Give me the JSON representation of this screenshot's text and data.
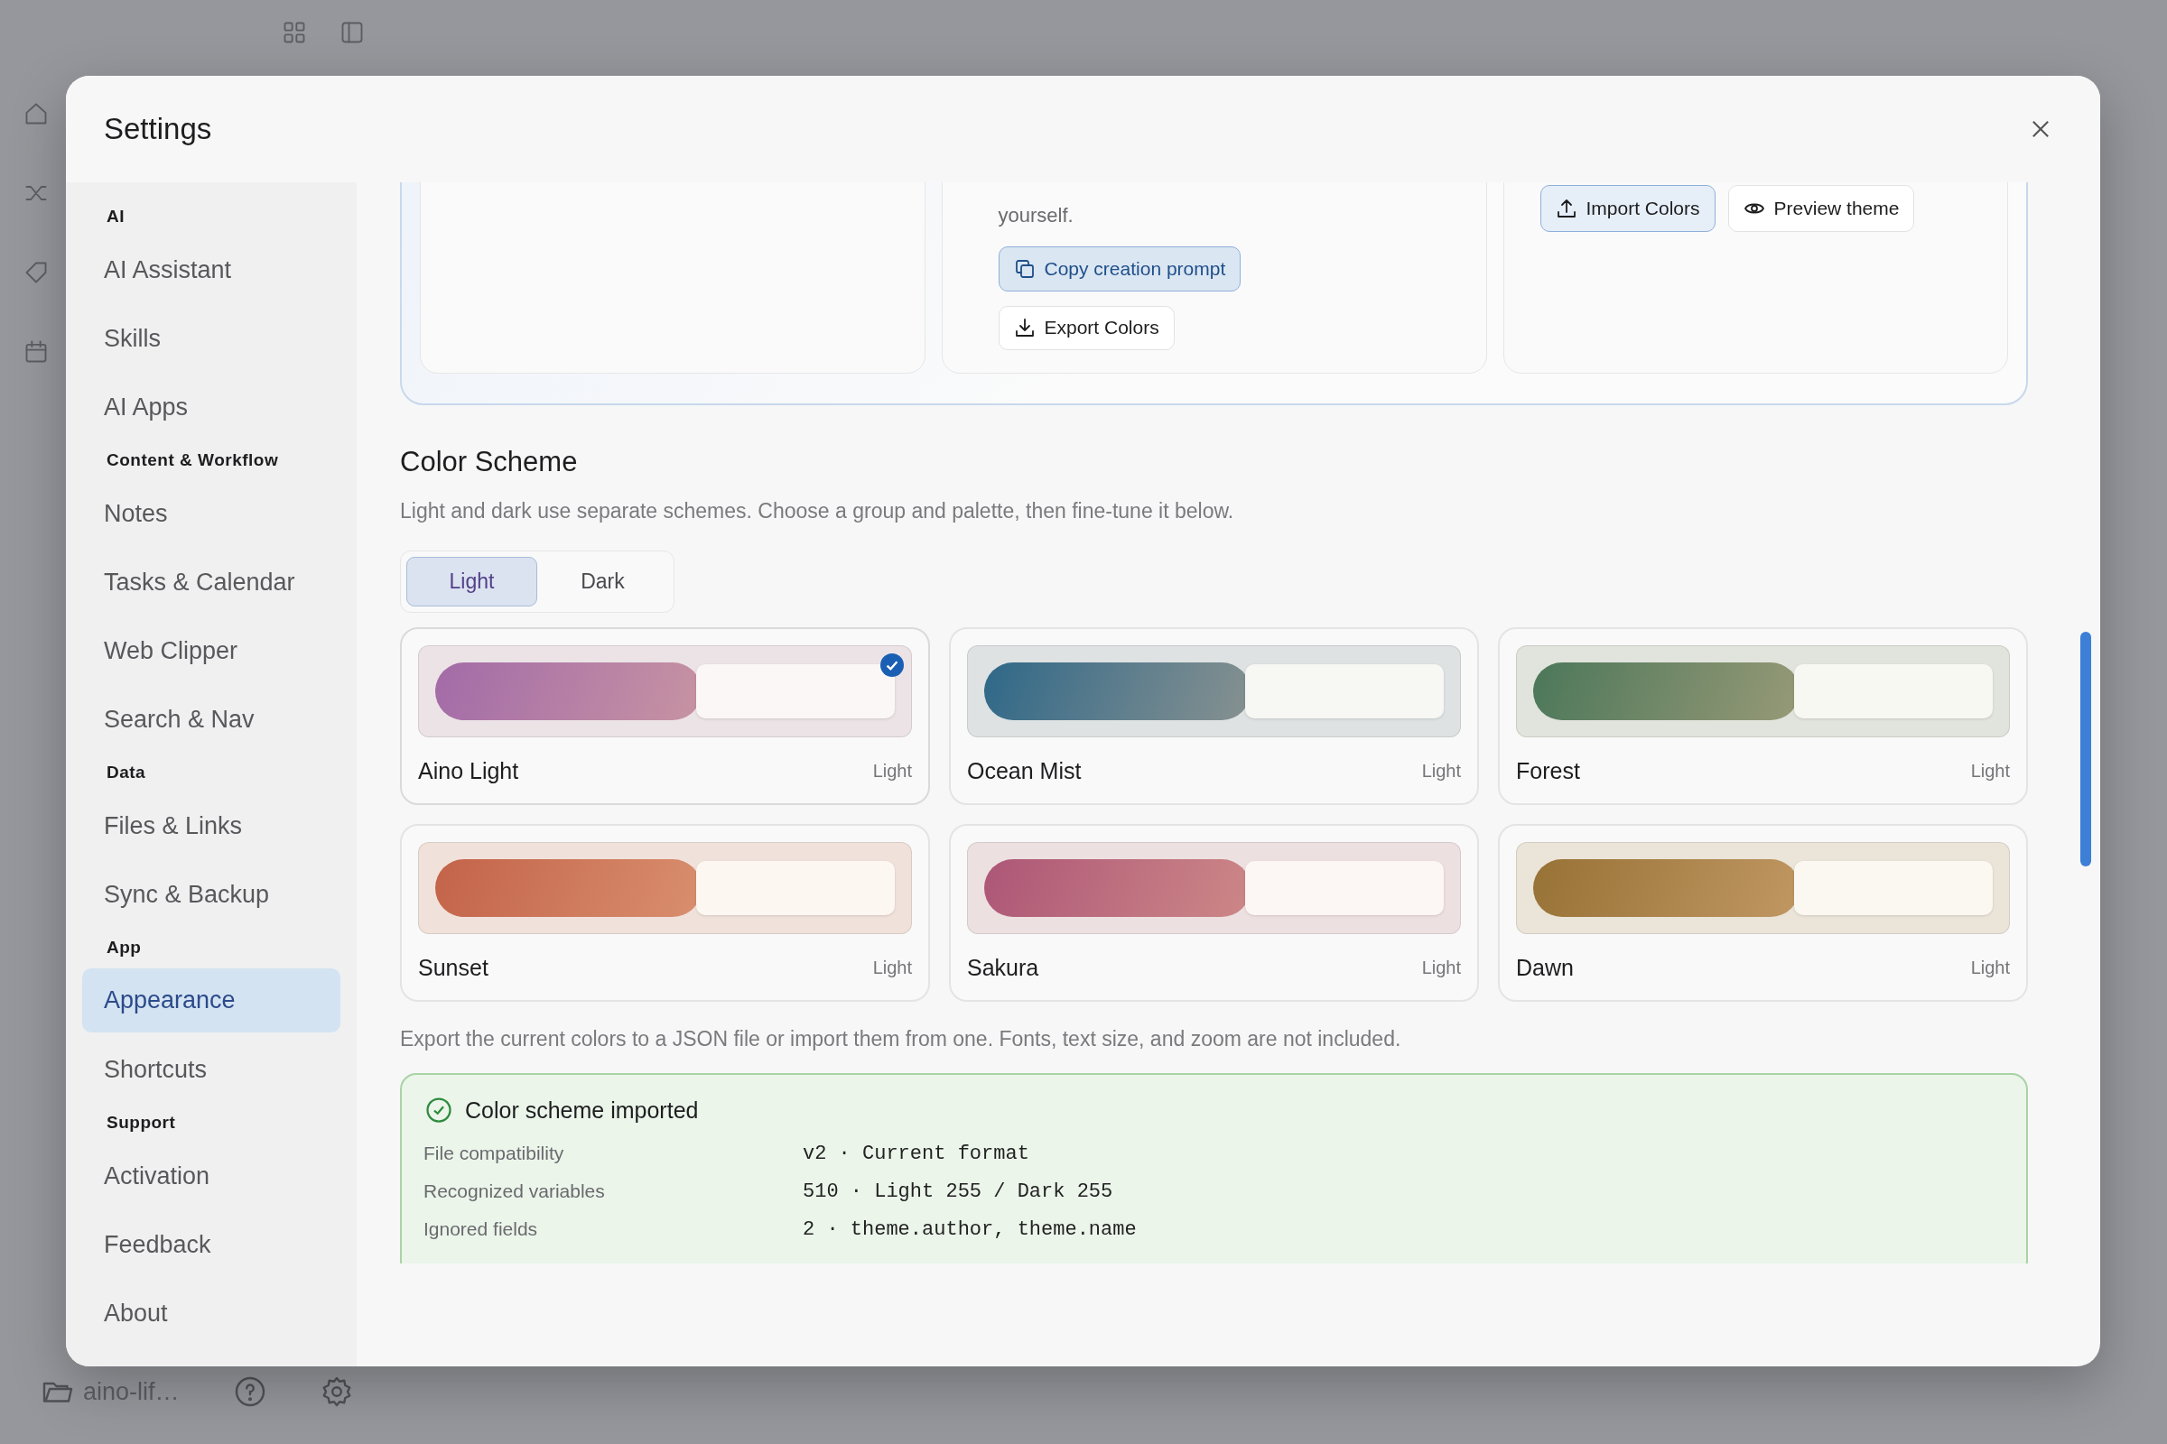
{
  "window": {
    "title": "Settings"
  },
  "sidebar": {
    "sections": [
      {
        "label": "AI",
        "items": [
          {
            "label": "AI Assistant",
            "selected": false
          },
          {
            "label": "Skills",
            "selected": false
          },
          {
            "label": "AI Apps",
            "selected": false
          }
        ]
      },
      {
        "label": "Content & Workflow",
        "items": [
          {
            "label": "Notes",
            "selected": false
          },
          {
            "label": "Tasks & Calendar",
            "selected": false
          },
          {
            "label": "Web Clipper",
            "selected": false
          },
          {
            "label": "Search & Nav",
            "selected": false
          }
        ]
      },
      {
        "label": "Data",
        "items": [
          {
            "label": "Files & Links",
            "selected": false
          },
          {
            "label": "Sync & Backup",
            "selected": false
          }
        ]
      },
      {
        "label": "App",
        "items": [
          {
            "label": "Appearance",
            "selected": true
          },
          {
            "label": "Shortcuts",
            "selected": false
          }
        ]
      },
      {
        "label": "Support",
        "items": [
          {
            "label": "Activation",
            "selected": false
          },
          {
            "label": "Feedback",
            "selected": false
          },
          {
            "label": "About",
            "selected": false
          }
        ]
      }
    ]
  },
  "theme_panel": {
    "description": "yourself.",
    "create_buttons": [
      {
        "label": "Copy creation prompt",
        "kind": "copy",
        "highlighted": true
      },
      {
        "label": "Export Colors",
        "kind": "export",
        "highlighted": false
      }
    ],
    "import_buttons": [
      {
        "label": "Import Colors",
        "kind": "import",
        "highlighted": true
      },
      {
        "label": "Preview theme",
        "kind": "preview",
        "highlighted": false
      }
    ]
  },
  "color_scheme": {
    "title": "Color Scheme",
    "description": "Light and dark use separate schemes. Choose a group and palette, then fine-tune it below.",
    "modes": [
      {
        "label": "Light",
        "selected": true
      },
      {
        "label": "Dark",
        "selected": false
      }
    ],
    "schemes": [
      {
        "name": "Aino Light",
        "mode": "Light",
        "selected": true,
        "color": "#a36ba8"
      },
      {
        "name": "Ocean Mist",
        "mode": "Light",
        "selected": false,
        "color": "#2d6888"
      },
      {
        "name": "Forest",
        "mode": "Light",
        "selected": false,
        "color": "#4b775a"
      },
      {
        "name": "Sunset",
        "mode": "Light",
        "selected": false,
        "color": "#c3634a"
      },
      {
        "name": "Sakura",
        "mode": "Light",
        "selected": false,
        "color": "#ad5677"
      },
      {
        "name": "Dawn",
        "mode": "Light",
        "selected": false,
        "color": "#977235"
      }
    ]
  },
  "export_note": "Export the current colors to a JSON file or import them from one. Fonts, text size, and zoom are not included.",
  "import_result": {
    "title": "Color scheme imported",
    "rows": [
      {
        "label": "File compatibility",
        "value": "v2 · Current format"
      },
      {
        "label": "Recognized variables",
        "value": "510 · Light 255 / Dark 255"
      },
      {
        "label": "Ignored fields",
        "value": "2 · theme.author, theme.name"
      }
    ]
  },
  "app_footer": {
    "folder": "aino-lif…"
  }
}
